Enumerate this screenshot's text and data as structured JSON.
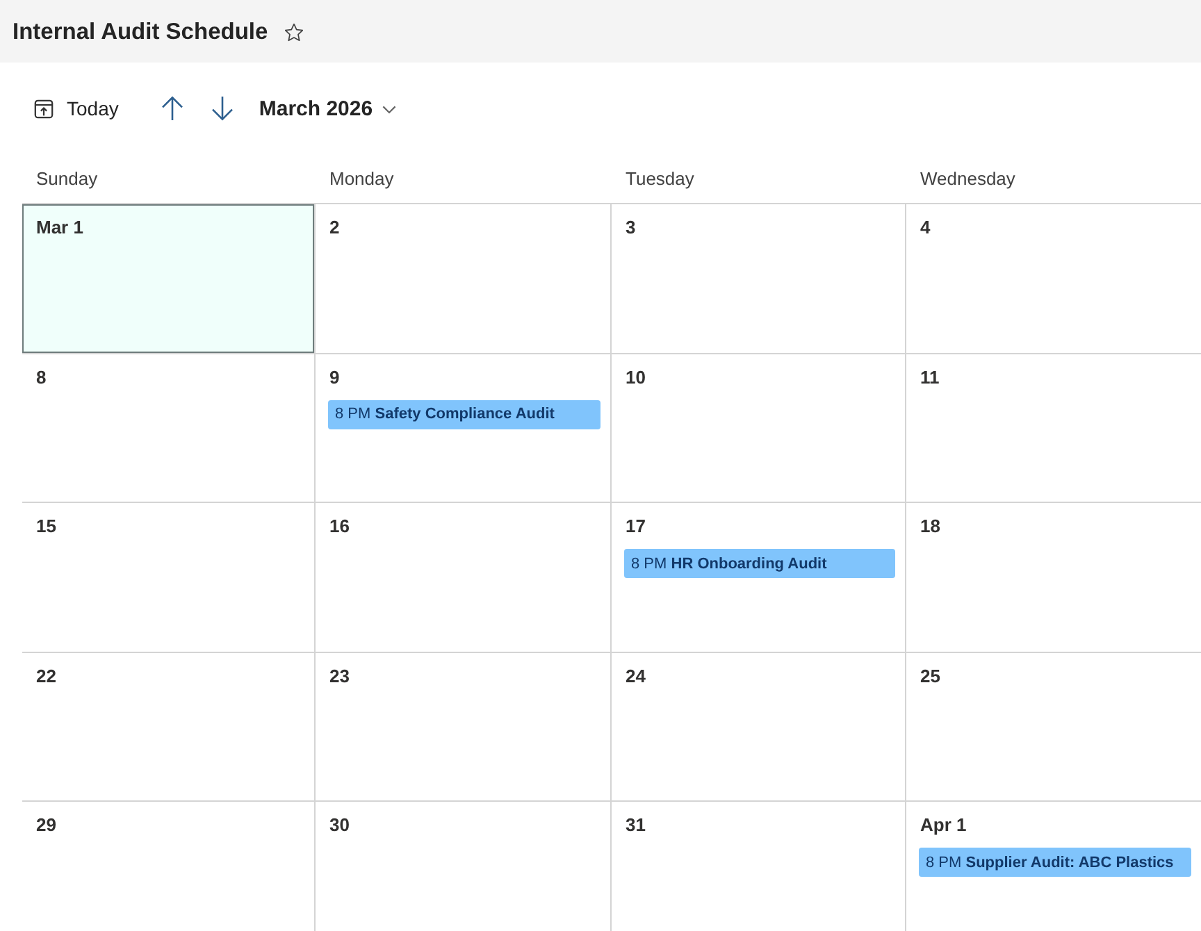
{
  "header": {
    "title": "Internal Audit Schedule",
    "favorite": false
  },
  "toolbar": {
    "today_label": "Today",
    "month_label": "March 2026"
  },
  "calendar": {
    "weekdays": [
      "Sunday",
      "Monday",
      "Tuesday",
      "Wednesday"
    ],
    "weeks": [
      [
        {
          "date": "Mar 1",
          "selected": true
        },
        {
          "date": "2",
          "selected": false
        },
        {
          "date": "3",
          "selected": false
        },
        {
          "date": "4",
          "selected": false
        }
      ],
      [
        {
          "date": "8",
          "selected": false
        },
        {
          "date": "9",
          "selected": false,
          "events": [
            {
              "time": "8 PM",
              "title": "Safety Compliance Audit"
            }
          ]
        },
        {
          "date": "10",
          "selected": false
        },
        {
          "date": "11",
          "selected": false
        }
      ],
      [
        {
          "date": "15",
          "selected": false
        },
        {
          "date": "16",
          "selected": false
        },
        {
          "date": "17",
          "selected": false,
          "events": [
            {
              "time": "8 PM",
              "title": "HR Onboarding Audit"
            }
          ]
        },
        {
          "date": "18",
          "selected": false
        }
      ],
      [
        {
          "date": "22",
          "selected": false
        },
        {
          "date": "23",
          "selected": false
        },
        {
          "date": "24",
          "selected": false
        },
        {
          "date": "25",
          "selected": false
        }
      ],
      [
        {
          "date": "29",
          "selected": false
        },
        {
          "date": "30",
          "selected": false
        },
        {
          "date": "31",
          "selected": false
        },
        {
          "date": "Apr 1",
          "selected": false,
          "events": [
            {
              "time": "8 PM",
              "title": "Supplier Audit: ABC Plastics"
            }
          ]
        }
      ]
    ]
  }
}
